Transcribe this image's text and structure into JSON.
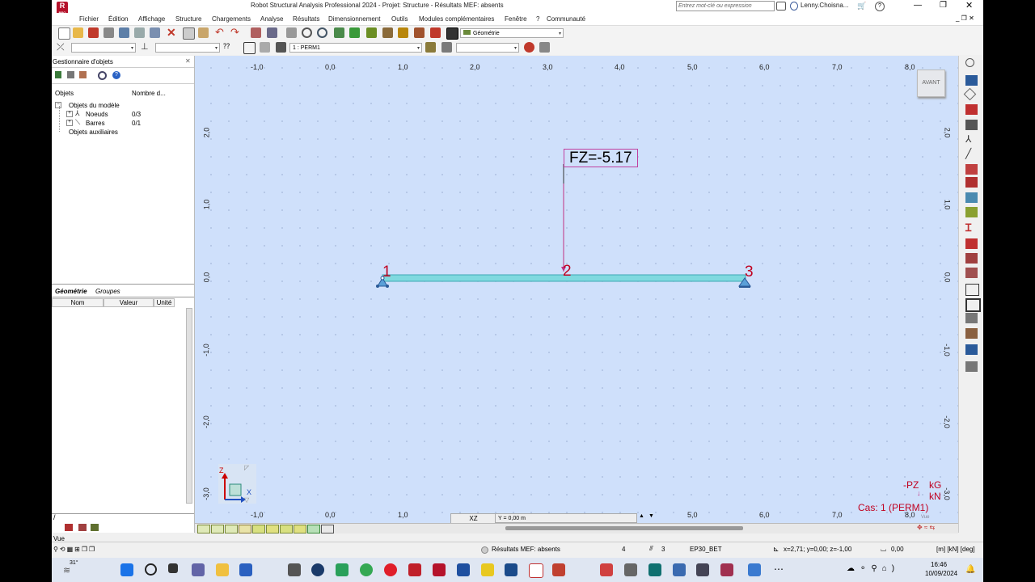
{
  "titlebar": {
    "title": "Robot Structural Analysis Professional 2024 - Projet: Structure - Résultats MEF: absents",
    "search_placeholder": "Entrez mot-clé ou expression",
    "user": "Lenny.Choisna...",
    "app_logo": "R",
    "app_logo_sub": "PRO"
  },
  "menu": [
    "Fichier",
    "Édition",
    "Affichage",
    "Structure",
    "Chargements",
    "Analyse",
    "Résultats",
    "Dimensionnement",
    "Outils",
    "Modules complémentaires",
    "Fenêtre",
    "?",
    "Communauté"
  ],
  "toolbar": {
    "view_combo": "Géométrie",
    "load_case_combo": "1 : PERM1"
  },
  "object_manager": {
    "title": "Gestionnaire d'objets",
    "col_objects": "Objets",
    "col_count": "Nombre d...",
    "root": "Objets du modèle",
    "nodes_label": "Noeuds",
    "nodes_count": "0/3",
    "bars_label": "Barres",
    "bars_count": "0/1",
    "aux": "Objets auxiliaires",
    "tabs": [
      "Géométrie",
      "Groupes"
    ],
    "props_headers": [
      "Nom",
      "Valeur",
      "Unité"
    ]
  },
  "canvas": {
    "top_ticks": [
      "-1,0",
      "0,0",
      "1,0",
      "2,0",
      "3,0",
      "4,0",
      "5,0",
      "6,0",
      "7,0",
      "8,0"
    ],
    "bottom_ticks": [
      "-1,0",
      "0,0",
      "1,0",
      "5,0",
      "6,0",
      "7,0",
      "8,0"
    ],
    "left_ticks": [
      "2,0",
      "1,0",
      "0,0",
      "-1,0",
      "-2,0",
      "-3,0"
    ],
    "right_ticks": [
      "2,0",
      "1,0",
      "0,0",
      "-1,0",
      "-2,0",
      "-3,0"
    ],
    "view_cube": "AVANT",
    "load_label": "FZ=-5.17",
    "nodes": [
      "1",
      "2",
      "3"
    ],
    "axis_z": "Z",
    "axis_x": "X",
    "legend_pz": "-PZ",
    "legend_unit1": "kG",
    "legend_unit2": "kN",
    "case_label": "Cas: 1 (PERM1)",
    "plane": "XZ",
    "y_field": "Y = 0,00 m",
    "vue_corner": "Vue"
  },
  "status": {
    "vue_label": "Vue",
    "results": "Résultats MEF: absents",
    "num1": "4",
    "num2": "3",
    "material": "EP30_BET",
    "coords": "x=2,71; y=0,00; z=-1,00",
    "angle": "0,00",
    "units": "[m] [kN] [deg]"
  },
  "taskbar": {
    "temp": "31°",
    "time": "16:46",
    "date": "10/09/2024"
  },
  "colors": {
    "canvas_bg": "#cfe0fb",
    "bar_fill": "#7fd9df",
    "node_label": "#c00020",
    "load_line": "#c03080",
    "case_text": "#c00020"
  }
}
